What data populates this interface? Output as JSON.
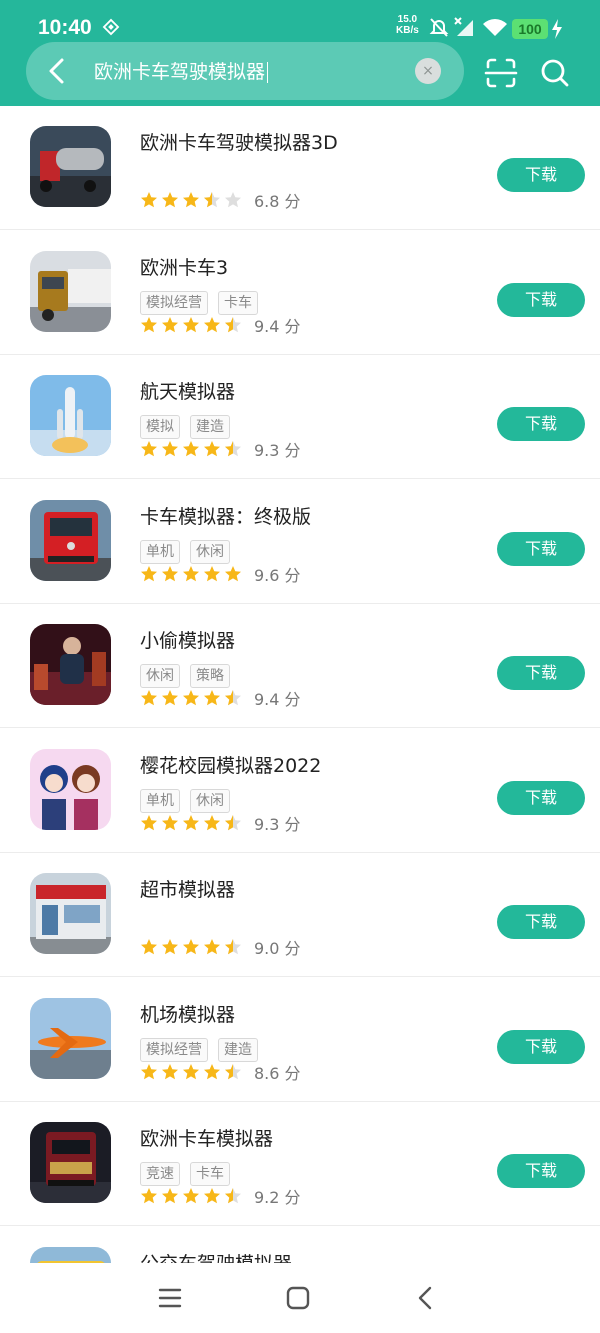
{
  "status": {
    "time": "10:40",
    "net_speed_value": "15.0",
    "net_speed_unit": "KB/s",
    "battery": "100"
  },
  "search": {
    "query": "欧洲卡车驾驶模拟器",
    "clear_symbol": "×"
  },
  "colors": {
    "brand": "#25b79b",
    "button": "#23b89a",
    "star": "#f7b718",
    "star_empty": "#dedede"
  },
  "apps": [
    {
      "title": "欧洲卡车驾驶模拟器3D",
      "tags": [],
      "stars": 3.5,
      "score": "6.8 分",
      "button": "下载"
    },
    {
      "title": "欧洲卡车3",
      "tags": [
        "模拟经营",
        "卡车"
      ],
      "stars": 4.5,
      "score": "9.4 分",
      "button": "下载"
    },
    {
      "title": "航天模拟器",
      "tags": [
        "模拟",
        "建造"
      ],
      "stars": 4.5,
      "score": "9.3 分",
      "button": "下载"
    },
    {
      "title": "卡车模拟器：终极版",
      "tags": [
        "单机",
        "休闲"
      ],
      "stars": 5,
      "score": "9.6 分",
      "button": "下载"
    },
    {
      "title": "小偷模拟器",
      "tags": [
        "休闲",
        "策略"
      ],
      "stars": 4.5,
      "score": "9.4 分",
      "button": "下载"
    },
    {
      "title": "樱花校园模拟器2022",
      "tags": [
        "单机",
        "休闲"
      ],
      "stars": 4.5,
      "score": "9.3 分",
      "button": "下载"
    },
    {
      "title": "超市模拟器",
      "tags": [],
      "stars": 4.5,
      "score": "9.0 分",
      "button": "下载"
    },
    {
      "title": "机场模拟器",
      "tags": [
        "模拟经营",
        "建造"
      ],
      "stars": 4.5,
      "score": "8.6 分",
      "button": "下载"
    },
    {
      "title": "欧洲卡车模拟器",
      "tags": [
        "竞速",
        "卡车"
      ],
      "stars": 4.5,
      "score": "9.2 分",
      "button": "下载"
    },
    {
      "title": "公交车驾驶模拟器",
      "tags": [],
      "stars": 0,
      "score": "",
      "button": ""
    }
  ],
  "icons": {
    "back": "chevron-left-icon",
    "scan": "scan-icon",
    "search": "search-icon",
    "nav_menu": "menu-icon",
    "nav_home": "home-icon",
    "nav_back": "back-icon"
  }
}
